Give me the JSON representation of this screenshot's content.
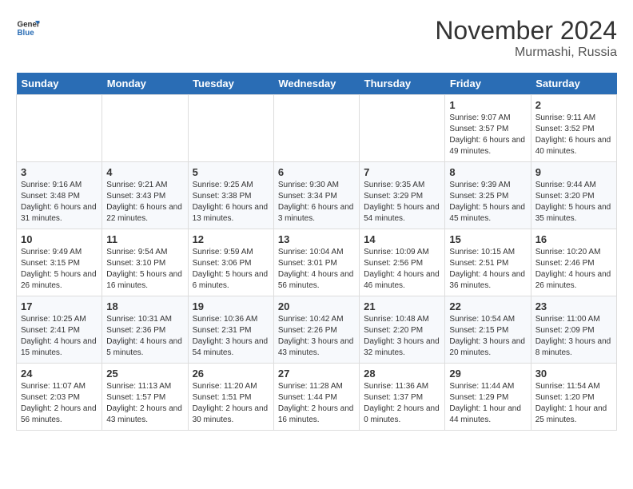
{
  "app": {
    "logo_line1": "General",
    "logo_line2": "Blue",
    "title": "November 2024",
    "subtitle": "Murmashi, Russia"
  },
  "calendar": {
    "headers": [
      "Sunday",
      "Monday",
      "Tuesday",
      "Wednesday",
      "Thursday",
      "Friday",
      "Saturday"
    ],
    "weeks": [
      [
        {
          "day": "",
          "info": ""
        },
        {
          "day": "",
          "info": ""
        },
        {
          "day": "",
          "info": ""
        },
        {
          "day": "",
          "info": ""
        },
        {
          "day": "",
          "info": ""
        },
        {
          "day": "1",
          "info": "Sunrise: 9:07 AM\nSunset: 3:57 PM\nDaylight: 6 hours and 49 minutes."
        },
        {
          "day": "2",
          "info": "Sunrise: 9:11 AM\nSunset: 3:52 PM\nDaylight: 6 hours and 40 minutes."
        }
      ],
      [
        {
          "day": "3",
          "info": "Sunrise: 9:16 AM\nSunset: 3:48 PM\nDaylight: 6 hours and 31 minutes."
        },
        {
          "day": "4",
          "info": "Sunrise: 9:21 AM\nSunset: 3:43 PM\nDaylight: 6 hours and 22 minutes."
        },
        {
          "day": "5",
          "info": "Sunrise: 9:25 AM\nSunset: 3:38 PM\nDaylight: 6 hours and 13 minutes."
        },
        {
          "day": "6",
          "info": "Sunrise: 9:30 AM\nSunset: 3:34 PM\nDaylight: 6 hours and 3 minutes."
        },
        {
          "day": "7",
          "info": "Sunrise: 9:35 AM\nSunset: 3:29 PM\nDaylight: 5 hours and 54 minutes."
        },
        {
          "day": "8",
          "info": "Sunrise: 9:39 AM\nSunset: 3:25 PM\nDaylight: 5 hours and 45 minutes."
        },
        {
          "day": "9",
          "info": "Sunrise: 9:44 AM\nSunset: 3:20 PM\nDaylight: 5 hours and 35 minutes."
        }
      ],
      [
        {
          "day": "10",
          "info": "Sunrise: 9:49 AM\nSunset: 3:15 PM\nDaylight: 5 hours and 26 minutes."
        },
        {
          "day": "11",
          "info": "Sunrise: 9:54 AM\nSunset: 3:10 PM\nDaylight: 5 hours and 16 minutes."
        },
        {
          "day": "12",
          "info": "Sunrise: 9:59 AM\nSunset: 3:06 PM\nDaylight: 5 hours and 6 minutes."
        },
        {
          "day": "13",
          "info": "Sunrise: 10:04 AM\nSunset: 3:01 PM\nDaylight: 4 hours and 56 minutes."
        },
        {
          "day": "14",
          "info": "Sunrise: 10:09 AM\nSunset: 2:56 PM\nDaylight: 4 hours and 46 minutes."
        },
        {
          "day": "15",
          "info": "Sunrise: 10:15 AM\nSunset: 2:51 PM\nDaylight: 4 hours and 36 minutes."
        },
        {
          "day": "16",
          "info": "Sunrise: 10:20 AM\nSunset: 2:46 PM\nDaylight: 4 hours and 26 minutes."
        }
      ],
      [
        {
          "day": "17",
          "info": "Sunrise: 10:25 AM\nSunset: 2:41 PM\nDaylight: 4 hours and 15 minutes."
        },
        {
          "day": "18",
          "info": "Sunrise: 10:31 AM\nSunset: 2:36 PM\nDaylight: 4 hours and 5 minutes."
        },
        {
          "day": "19",
          "info": "Sunrise: 10:36 AM\nSunset: 2:31 PM\nDaylight: 3 hours and 54 minutes."
        },
        {
          "day": "20",
          "info": "Sunrise: 10:42 AM\nSunset: 2:26 PM\nDaylight: 3 hours and 43 minutes."
        },
        {
          "day": "21",
          "info": "Sunrise: 10:48 AM\nSunset: 2:20 PM\nDaylight: 3 hours and 32 minutes."
        },
        {
          "day": "22",
          "info": "Sunrise: 10:54 AM\nSunset: 2:15 PM\nDaylight: 3 hours and 20 minutes."
        },
        {
          "day": "23",
          "info": "Sunrise: 11:00 AM\nSunset: 2:09 PM\nDaylight: 3 hours and 8 minutes."
        }
      ],
      [
        {
          "day": "24",
          "info": "Sunrise: 11:07 AM\nSunset: 2:03 PM\nDaylight: 2 hours and 56 minutes."
        },
        {
          "day": "25",
          "info": "Sunrise: 11:13 AM\nSunset: 1:57 PM\nDaylight: 2 hours and 43 minutes."
        },
        {
          "day": "26",
          "info": "Sunrise: 11:20 AM\nSunset: 1:51 PM\nDaylight: 2 hours and 30 minutes."
        },
        {
          "day": "27",
          "info": "Sunrise: 11:28 AM\nSunset: 1:44 PM\nDaylight: 2 hours and 16 minutes."
        },
        {
          "day": "28",
          "info": "Sunrise: 11:36 AM\nSunset: 1:37 PM\nDaylight: 2 hours and 0 minutes."
        },
        {
          "day": "29",
          "info": "Sunrise: 11:44 AM\nSunset: 1:29 PM\nDaylight: 1 hour and 44 minutes."
        },
        {
          "day": "30",
          "info": "Sunrise: 11:54 AM\nSunset: 1:20 PM\nDaylight: 1 hour and 25 minutes."
        }
      ]
    ]
  }
}
